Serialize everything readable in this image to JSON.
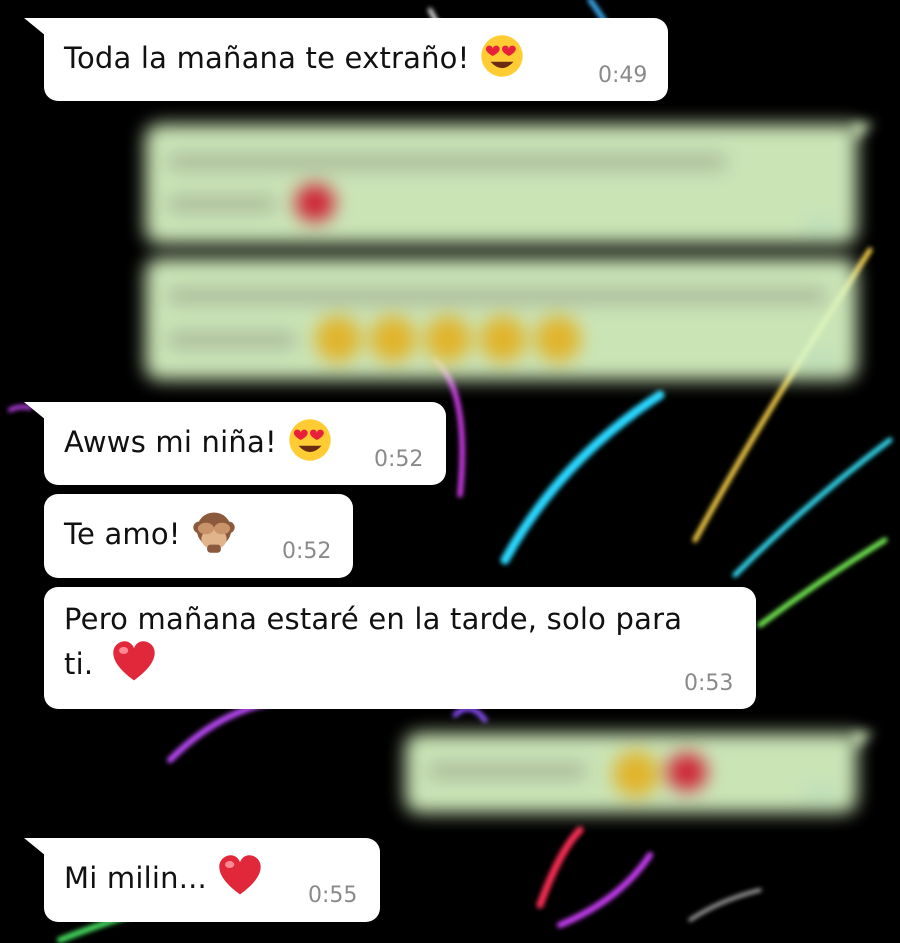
{
  "chat": {
    "incoming": [
      {
        "text": "Toda la mañana te extraño!",
        "time": "0:49",
        "emoji": "heart-eyes-face"
      },
      {
        "text": "Awws mi niña!",
        "time": "0:52",
        "emoji": "heart-eyes-face"
      },
      {
        "text": "Te amo!",
        "time": "0:52",
        "emoji": "see-no-evil-monkey"
      },
      {
        "text_line1": "Pero mañana estaré en la tarde, solo para",
        "text_line2": "ti.",
        "time": "0:53",
        "emoji": "red-heart"
      },
      {
        "text": "Mi milin...",
        "time": "0:55",
        "emoji": "red-heart"
      }
    ],
    "outgoing_blurred": [
      {
        "emojis": [
          "red-heart"
        ]
      },
      {
        "emojis": [
          "grinning-face",
          "grinning-face",
          "grinning-face",
          "grinning-face",
          "grinning-face"
        ]
      },
      {
        "emojis": [
          "grinning-face",
          "red-heart"
        ]
      }
    ]
  },
  "colors": {
    "background": "#000000",
    "incoming_bubble": "#ffffff",
    "outgoing_bubble": "#dcf8c6",
    "time_text": "#8a8a8a",
    "read_ticks": "#4fc3f7"
  }
}
